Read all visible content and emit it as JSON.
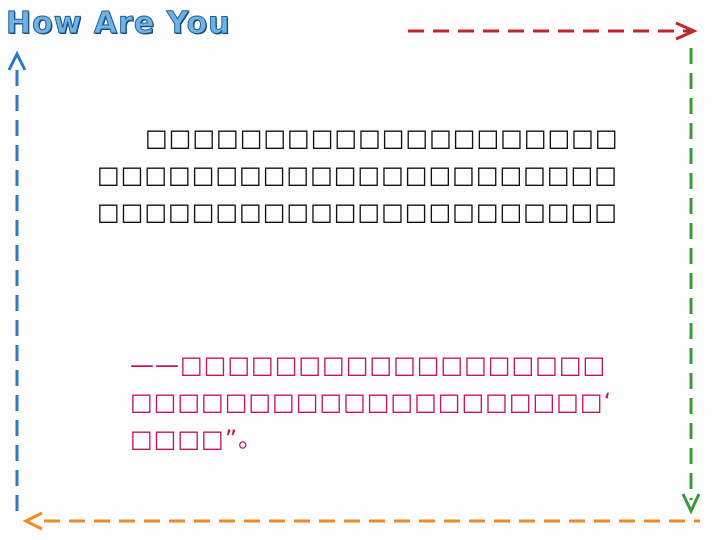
{
  "logo": {
    "text": "How Are You"
  },
  "body": {
    "lines": [
      "□□□□□□□□□□□□□□□□□□□□",
      "□□□□□□□□□□□□□□□□□□□□□□",
      "□□□□□□□□□□□□□□□□□□□□□□"
    ]
  },
  "quote": {
    "lines": [
      "——□□□□□□□□□□□□□□□□□□",
      "□□□□□□□□□□□□□□□□□□□□“□",
      "□□□□”。"
    ]
  },
  "colors": {
    "arrow_top": "#c0272d",
    "arrow_right": "#3a9a3a",
    "arrow_bottom": "#f08a24",
    "arrow_left": "#2f78c4",
    "logo": "#6fb3e3",
    "quote_text": "#c2185b"
  }
}
